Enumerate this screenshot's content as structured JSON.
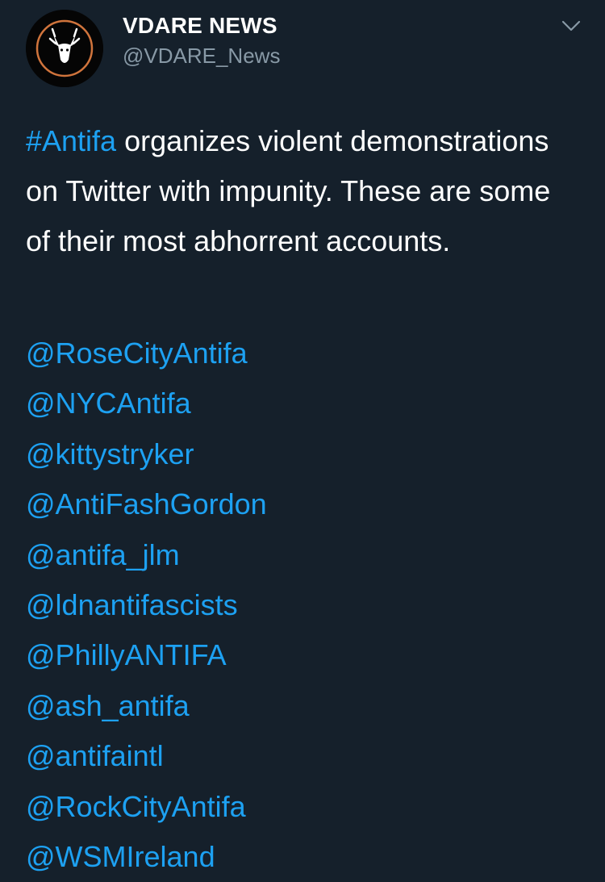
{
  "header": {
    "display_name": "VDARE NEWS",
    "handle": "@VDARE_News",
    "avatar_icon": "jackalope-logo-icon",
    "menu_icon": "chevron-down-icon"
  },
  "tweet": {
    "hashtag": "#Antifa",
    "text": " organizes violent demonstrations on Twitter with impunity. These are some of their most abhorrent accounts.",
    "mentions": [
      "@RoseCityAntifa",
      "@NYCAntifa",
      "@kittystryker",
      "@AntiFashGordon",
      "@antifa_jlm",
      "@ldnantifascists",
      "@PhillyANTIFA",
      "@ash_antifa",
      "@antifaintl",
      "@RockCityAntifa",
      "@WSMIreland"
    ]
  },
  "colors": {
    "background": "#15202b",
    "link": "#1da1f2",
    "secondary_text": "#8899a6",
    "logo_ring": "#d0743c"
  }
}
